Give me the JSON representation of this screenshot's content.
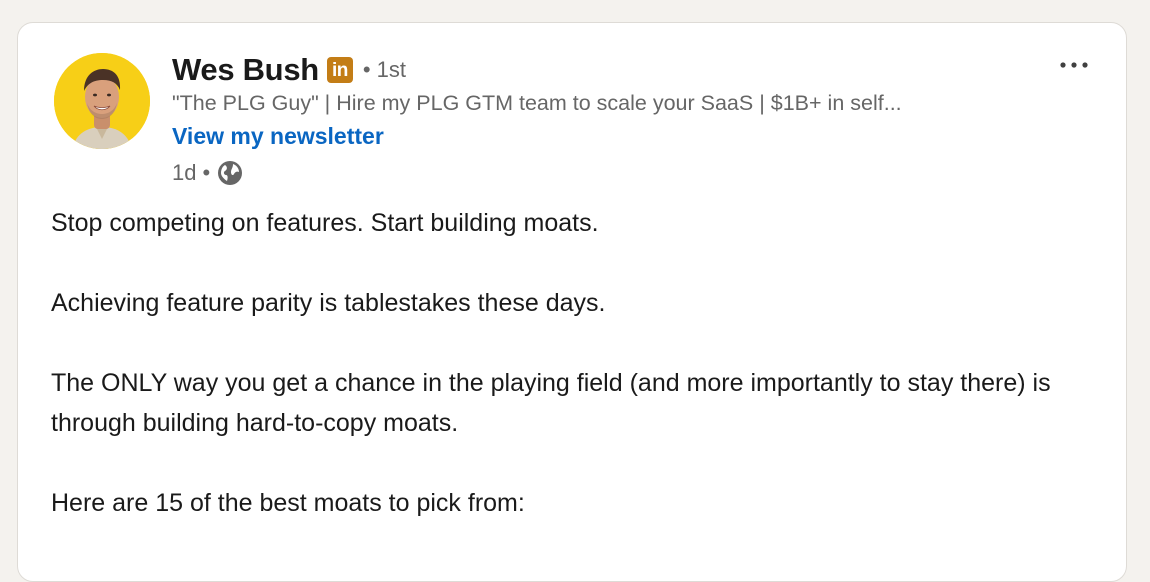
{
  "post": {
    "author": {
      "name": "Wes Bush",
      "badge_label": "in",
      "connection_degree": "1st",
      "headline": "\"The PLG Guy\" | Hire my PLG GTM team to scale your SaaS | $1B+ in self...",
      "newsletter_link": "View my newsletter",
      "avatar_background": "#f7cf17"
    },
    "meta": {
      "timestamp": "1d",
      "visibility_icon": "globe-icon"
    },
    "menu_icon": "more-horizontal-icon",
    "body": [
      "Stop competing on features. Start building moats.",
      "Achieving feature parity is tablestakes these days.",
      "The ONLY way you get a chance in the playing field (and more importantly to stay there) is through building hard-to-copy moats.",
      "Here are 15 of the best moats to pick from:"
    ]
  },
  "colors": {
    "page_background": "#f4f2ee",
    "card_background": "#ffffff",
    "link_blue": "#0a66c2",
    "badge_gold": "#c37d16"
  }
}
